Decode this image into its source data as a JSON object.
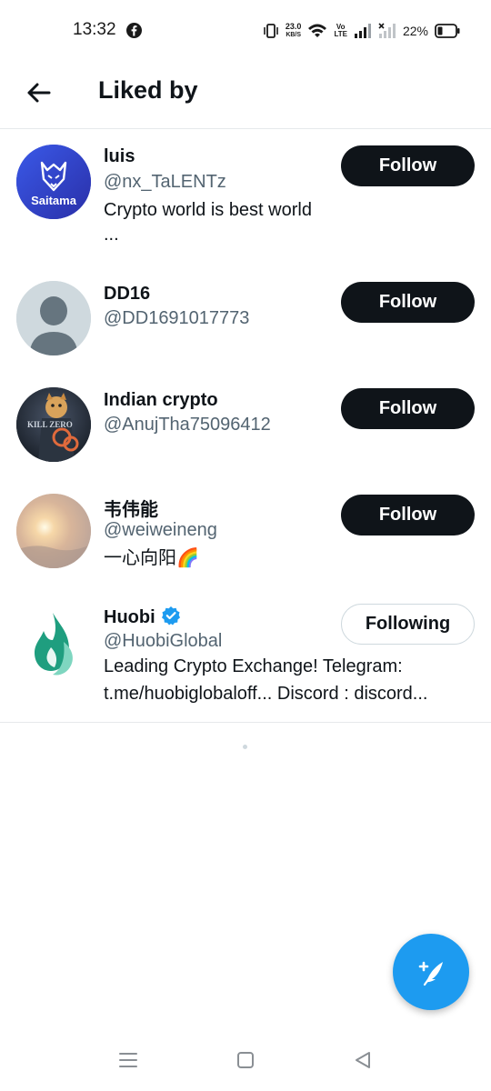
{
  "status_bar": {
    "time": "13:32",
    "net_speed_value": "23.0",
    "net_speed_unit": "KB/S",
    "volte_top": "Vo",
    "volte_bottom": "LTE",
    "battery_percent": "22%",
    "icons": [
      "facebook-icon",
      "vibrate-icon",
      "wifi-icon",
      "signal-icon",
      "no-signal-icon",
      "battery-icon"
    ]
  },
  "header": {
    "title": "Liked by",
    "back_icon": "arrow-left-icon"
  },
  "users": [
    {
      "name": "luis",
      "handle": "@nx_TaLENTz",
      "bio_lines": [
        "Crypto world is best world",
        "..."
      ],
      "button": "Follow",
      "avatar_text": "Saitama",
      "avatar_color": "#2f44c9"
    },
    {
      "name": "DD16",
      "handle": "@DD1691017773",
      "bio_lines": [],
      "button": "Follow",
      "avatar_color": "#cfd9de"
    },
    {
      "name": "Indian crypto",
      "handle": "@AnujTha75096412",
      "bio_lines": [],
      "button": "Follow",
      "avatar_text": "KILL ZERO",
      "avatar_color": "#1c2430"
    },
    {
      "name": "韦伟能",
      "handle": "@weiweineng",
      "bio_lines": [
        "一心向阳🌈"
      ],
      "button": "Follow",
      "avatar_color": "#d9c3b4"
    },
    {
      "name": "Huobi",
      "handle": "@HuobiGlobal",
      "verified": true,
      "bio_lines": [
        "Leading Crypto Exchange!  Telegram:",
        "t.me/huobiglobaloff... Discord : discord..."
      ],
      "button": "Following",
      "avatar_color": "#1fa484"
    }
  ],
  "fab": {
    "icon": "compose-tweet-icon",
    "color": "#1d9bf0"
  },
  "nav_bar": {
    "icons": [
      "menu-icon",
      "home-square-icon",
      "back-triangle-icon"
    ]
  }
}
